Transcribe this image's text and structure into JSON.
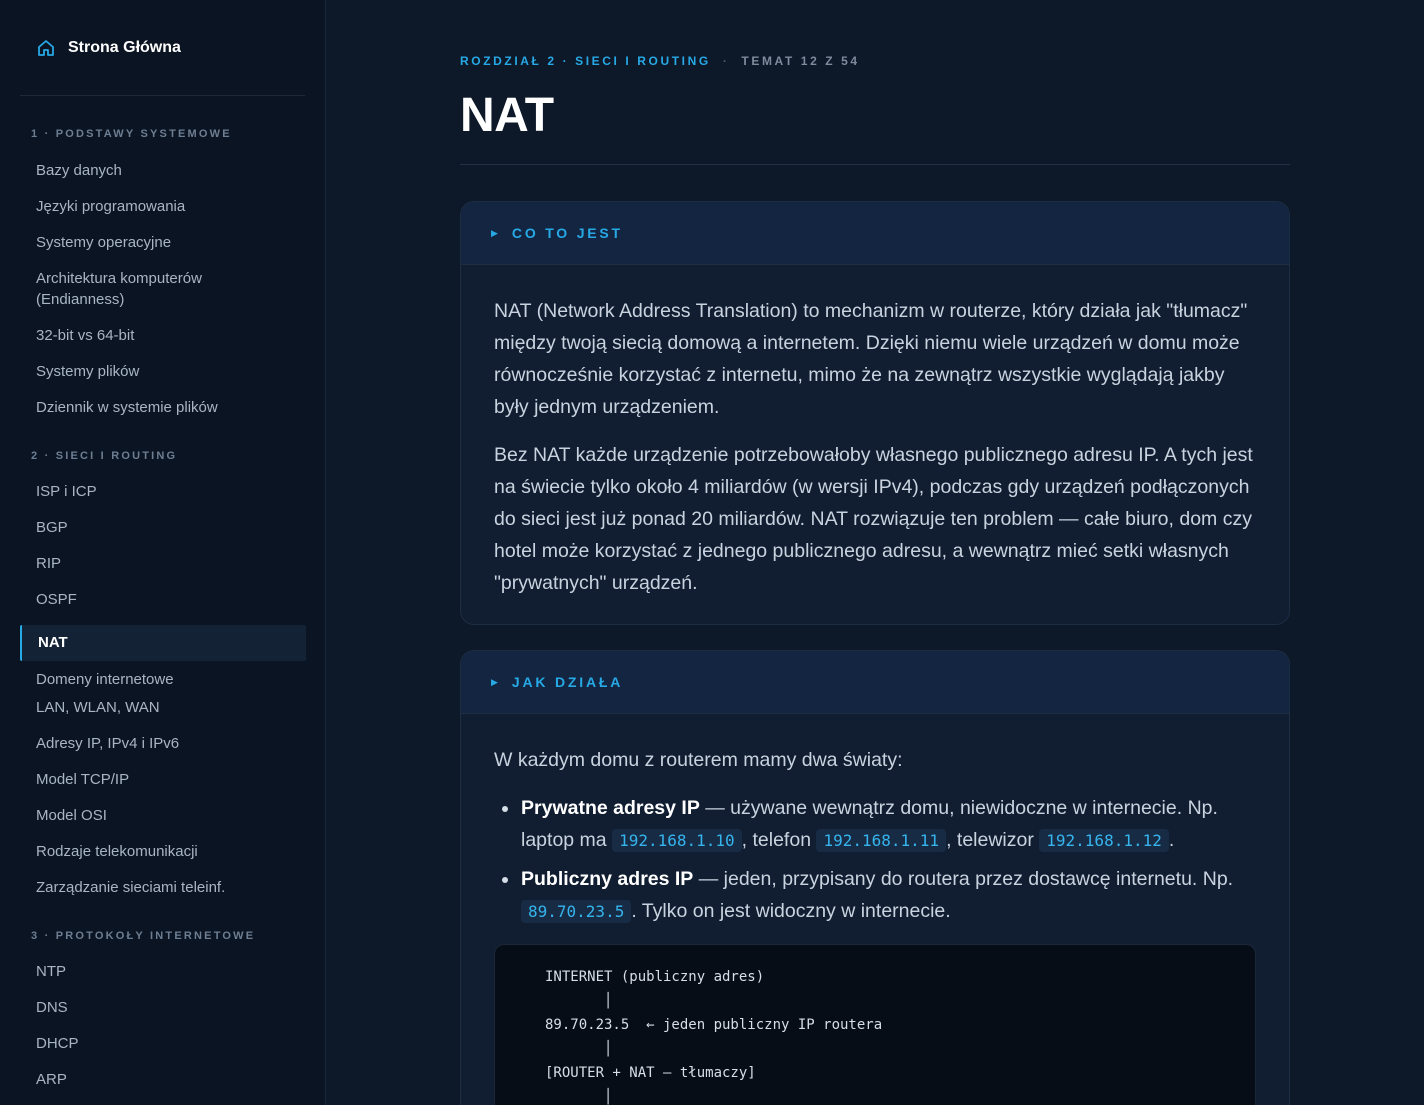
{
  "sidebar": {
    "home_label": "Strona Główna",
    "sections": [
      {
        "title": "1 · PODSTAWY SYSTEMOWE",
        "items": [
          "Bazy danych",
          "Języki programowania",
          "Systemy operacyjne",
          "Architektura komputerów (Endianness)",
          "32-bit vs 64-bit",
          "Systemy plików",
          "Dziennik w systemie plików"
        ]
      },
      {
        "title": "2 · SIECI I ROUTING",
        "items": [
          "ISP i ICP",
          "BGP",
          "RIP",
          "OSPF",
          "NAT",
          "Domeny internetowe",
          "LAN, WLAN, WAN",
          "Adresy IP, IPv4 i IPv6",
          "Model TCP/IP",
          "Model OSI",
          "Rodzaje telekomunikacji",
          "Zarządzanie sieciami teleinf."
        ]
      },
      {
        "title": "3 · PROTOKOŁY INTERNETOWE",
        "items": [
          "NTP",
          "DNS",
          "DHCP",
          "ARP"
        ]
      }
    ],
    "active_item": "NAT"
  },
  "breadcrumb": {
    "chapter": "ROZDZIAŁ 2 · SIECI I ROUTING",
    "separator": "·",
    "topic": "TEMAT 12 Z 54"
  },
  "page_title": "NAT",
  "card1": {
    "label": "CO TO JEST",
    "p1": "NAT (Network Address Translation) to mechanizm w routerze, który działa jak \"tłumacz\" między twoją siecią domową a internetem. Dzięki niemu wiele urządzeń w domu może równocześnie korzystać z internetu, mimo że na zewnątrz wszystkie wyglądają jakby były jednym urządzeniem.",
    "p2": "Bez NAT każde urządzenie potrzebowałoby własnego publicznego adresu IP. A tych jest na świecie tylko około 4 miliardów (w wersji IPv4), podczas gdy urządzeń podłączonych do sieci jest już ponad 20 miliardów. NAT rozwiązuje ten problem — całe biuro, dom czy hotel może korzystać z jednego publicznego adresu, a wewnątrz mieć setki własnych \"prywatnych\" urządzeń."
  },
  "card2": {
    "label": "JAK DZIAŁA",
    "intro": "W każdym domu z routerem mamy dwa światy:",
    "bullet1": {
      "strong": "Prywatne adresy IP",
      "text1": " — używane wewnątrz domu, niewidoczne w internecie. Np. laptop ma ",
      "ip1": "192.168.1.10",
      "text2": ", telefon ",
      "ip2": "192.168.1.11",
      "text3": ", telewizor ",
      "ip3": "192.168.1.12",
      "text4": "."
    },
    "bullet2": {
      "strong": "Publiczny adres IP",
      "text1": " — jeden, przypisany do routera przez dostawcę internetu. Np. ",
      "ip1": "89.70.23.5",
      "text2": ". Tylko on jest widoczny w internecie."
    },
    "code_lines": [
      "INTERNET (publiczny adres)",
      "       │",
      "89.70.23.5  ← jeden publiczny IP routera",
      "       │",
      "[ROUTER + NAT — tłumaczy]",
      "       │"
    ]
  },
  "colors": {
    "accent": "#27a9e6",
    "background": "#0d1828",
    "sidebar": "#0b1422"
  },
  "icons": {
    "home": "home-icon",
    "section_marker": "triangle-right-icon"
  }
}
